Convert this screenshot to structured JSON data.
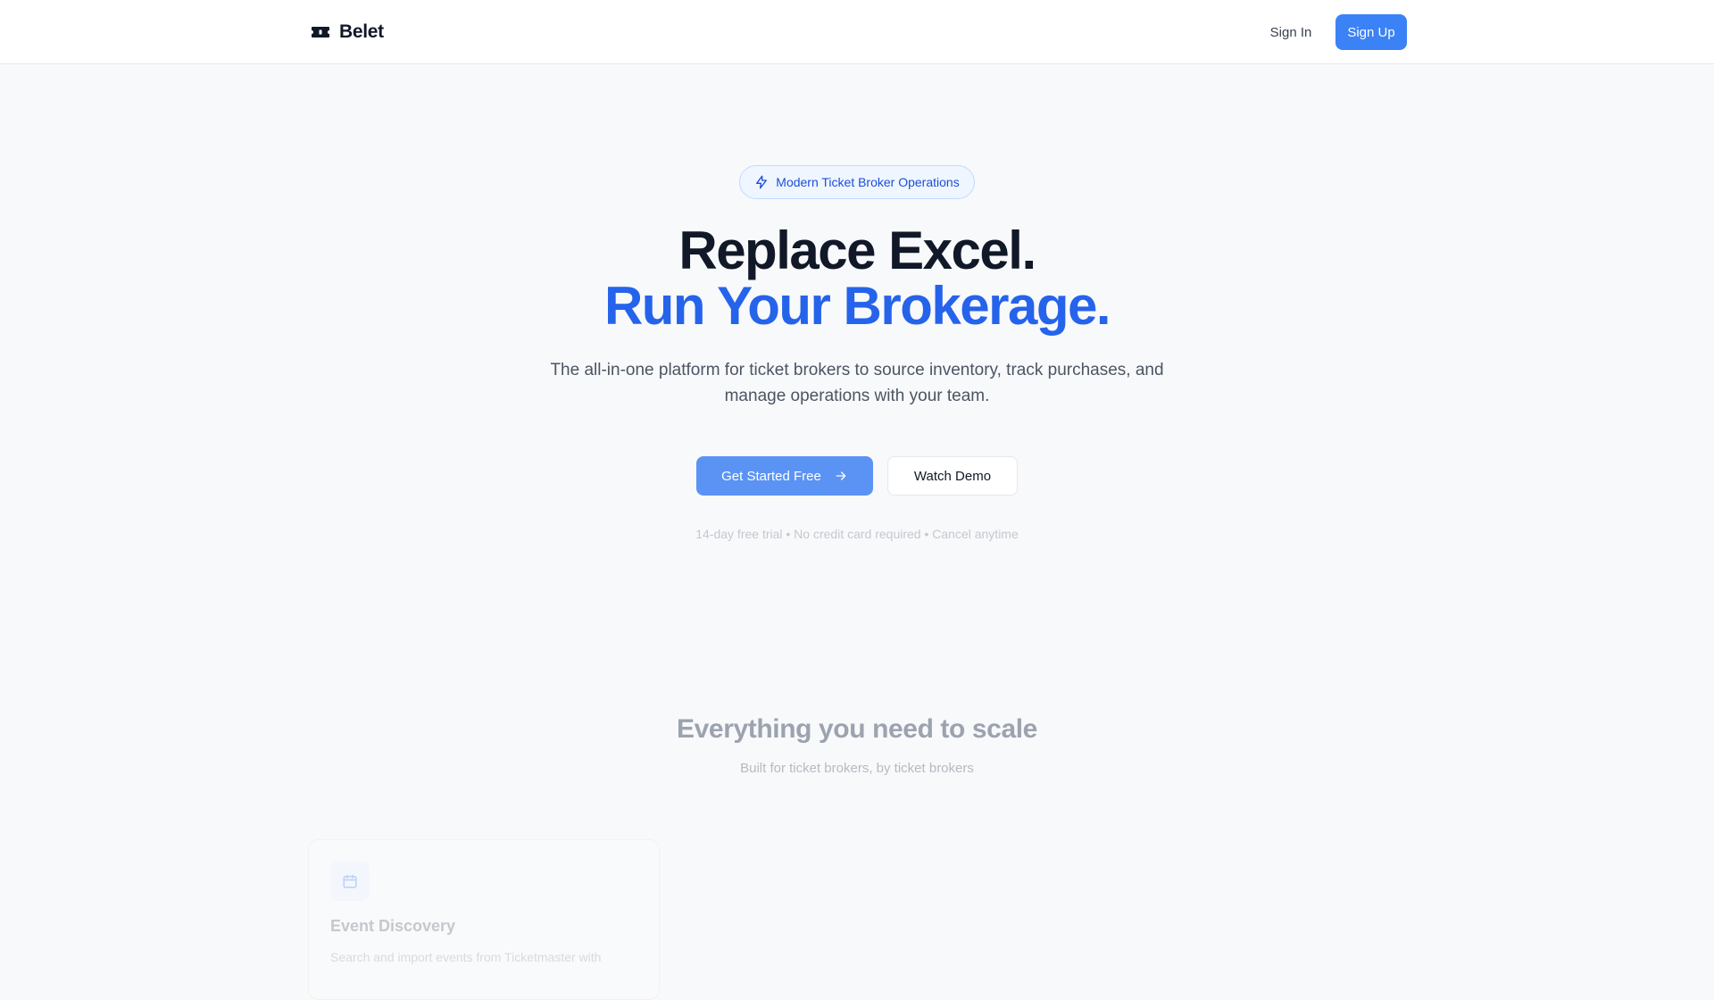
{
  "nav": {
    "brand": "Belet",
    "brand_icon": "ticket-icon",
    "signin_label": "Sign In",
    "signup_label": "Sign Up"
  },
  "hero": {
    "badge_label": "Modern Ticket Broker Operations",
    "badge_icon": "lightning-icon",
    "title_line1": "Replace Excel.",
    "title_line2": "Run Your Brokerage.",
    "subtitle": "The all-in-one platform for ticket brokers to source inventory, track purchases, and manage operations with your team.",
    "cta_primary": "Get Started Free",
    "cta_primary_icon": "arrow-right-icon",
    "cta_secondary": "Watch Demo",
    "trial_note": "14-day free trial • No credit card required • Cancel anytime"
  },
  "features": {
    "title": "Everything you need to scale",
    "subtitle": "Built for ticket brokers, by ticket brokers",
    "cards": [
      {
        "icon": "calendar-icon",
        "title": "Event Discovery",
        "description": "Search and import events from Ticketmaster with"
      }
    ]
  },
  "colors": {
    "accent": "#2563eb",
    "button": "#3b82f6",
    "background": "#f8f9fb"
  }
}
